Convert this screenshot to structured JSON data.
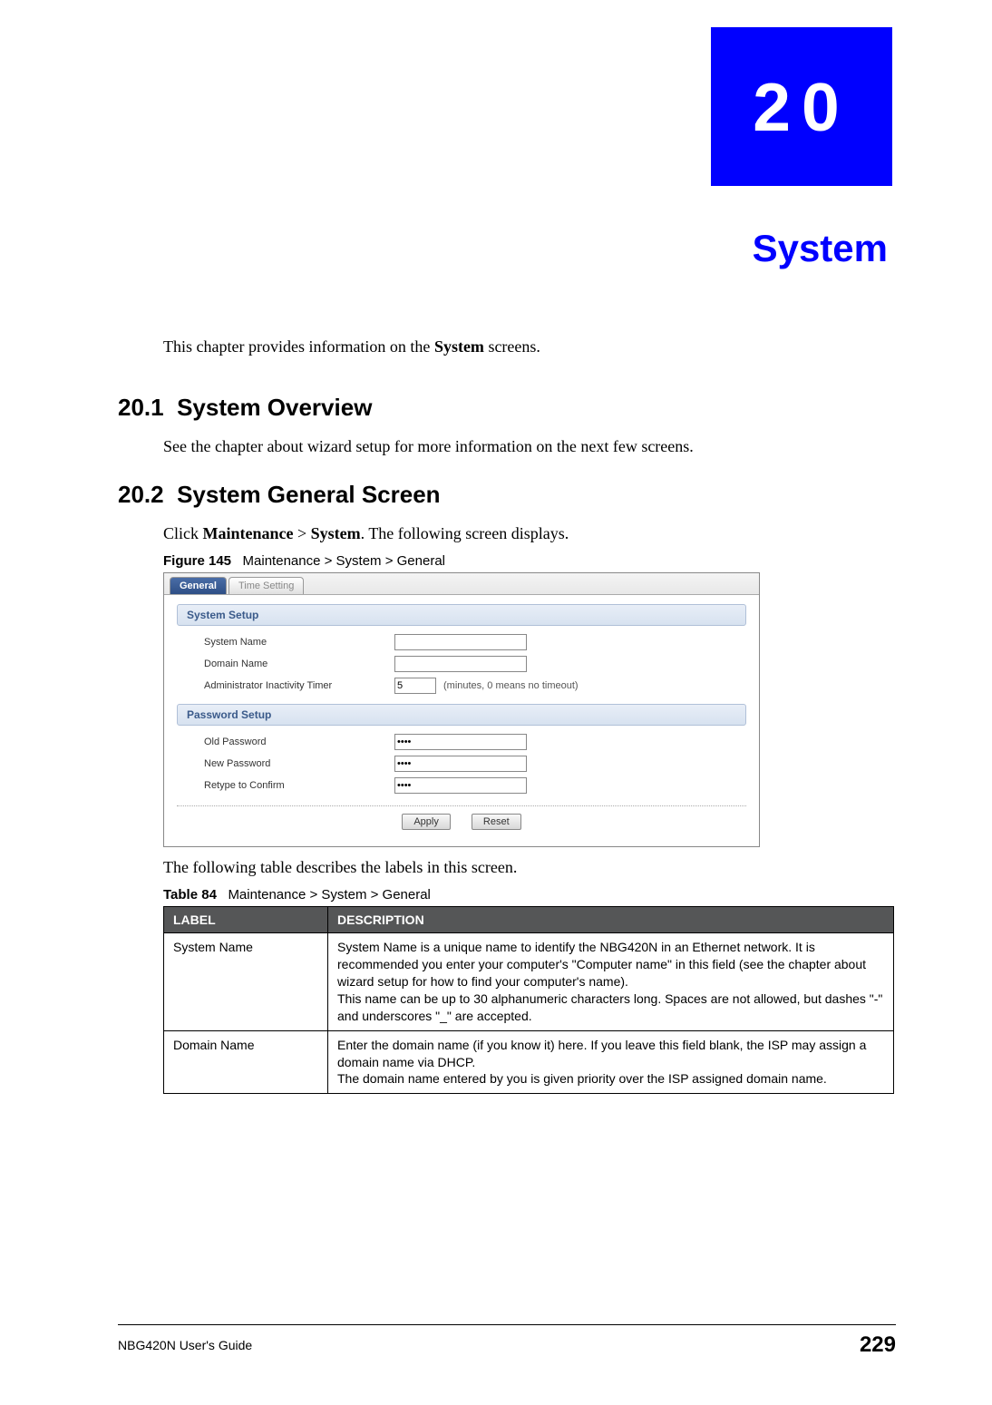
{
  "chapter": {
    "number": "20",
    "title": "System"
  },
  "intro": {
    "prefix": "This chapter provides information on the ",
    "bold": "System",
    "suffix": " screens."
  },
  "sections": {
    "s1": {
      "num": "20.1",
      "title": "System Overview",
      "body": "See the chapter about wizard setup for more information on the next few screens."
    },
    "s2": {
      "num": "20.2",
      "title": "System General Screen",
      "body_pre": "Click ",
      "b1": "Maintenance",
      "mid": " > ",
      "b2": "System",
      "body_post": ". The following screen displays."
    }
  },
  "figure": {
    "caption_label": "Figure 145",
    "caption_text": "Maintenance > System > General",
    "tab_active": "General",
    "tab_inactive": "Time Setting",
    "section1": "System Setup",
    "row_system_name": "System Name",
    "row_domain_name": "Domain Name",
    "row_admin_timer": "Administrator Inactivity Timer",
    "admin_value": "5",
    "admin_hint": "(minutes, 0 means no timeout)",
    "section2": "Password Setup",
    "row_old_pw": "Old Password",
    "row_new_pw": "New Password",
    "row_retype": "Retype to Confirm",
    "pw_value": "••••",
    "btn_apply": "Apply",
    "btn_reset": "Reset",
    "after": "The following table describes the labels in this screen."
  },
  "table": {
    "caption_label": "Table 84",
    "caption_text": "Maintenance > System > General",
    "h_label": "LABEL",
    "h_desc": "DESCRIPTION",
    "rows": [
      {
        "label": "System Name",
        "p1": "System Name is a unique name to identify the NBG420N in an Ethernet network. It is recommended you enter your computer's \"Computer name\" in this field (see the chapter about wizard setup for how to find your computer's name).",
        "p2": "This name can be up to 30 alphanumeric characters long. Spaces are not allowed, but dashes \"-\" and underscores \"_\" are accepted."
      },
      {
        "label": "Domain Name",
        "p1": "Enter the domain name (if you know it) here. If you leave this field blank, the ISP may assign a domain name via DHCP.",
        "p2": "The domain name entered by you is given priority over the ISP assigned domain name."
      }
    ]
  },
  "footer": {
    "guide": "NBG420N User's Guide",
    "page": "229"
  }
}
